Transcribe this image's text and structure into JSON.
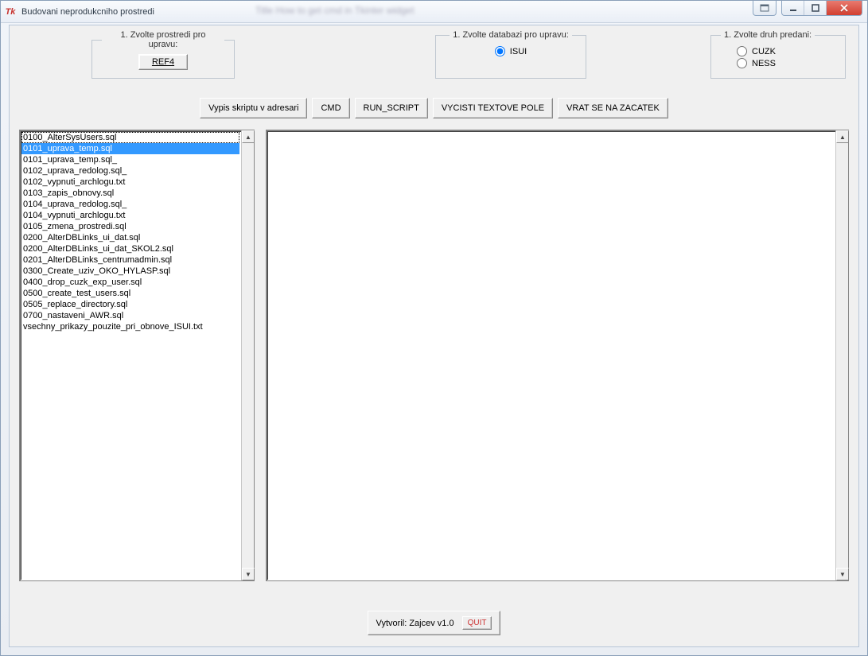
{
  "window": {
    "title": "Budovani neprodukcniho prostredi",
    "blurred_bg_text": "Title    How to get cmd in Tkinter widget"
  },
  "groups": {
    "prostredi": {
      "legend": "1. Zvolte prostredi pro upravu:",
      "button": "REF4"
    },
    "database": {
      "legend": "1. Zvolte databazi pro upravu:",
      "radio": "ISUI",
      "radio_checked": true
    },
    "predani": {
      "legend": "1. Zvolte druh predani:",
      "options": [
        "CUZK",
        "NESS"
      ],
      "selected": null
    }
  },
  "toolbar": {
    "vypis": "Vypis skriptu v adresari",
    "cmd": "CMD",
    "run": "RUN_SCRIPT",
    "vycisti": "VYCISTI TEXTOVE POLE",
    "vrat": "VRAT SE NA ZACATEK"
  },
  "file_list": {
    "selected_index": 1,
    "focused_index": 0,
    "items": [
      "0100_AlterSysUsers.sql",
      "0101_uprava_temp.sql",
      "0101_uprava_temp.sql_",
      "0102_uprava_redolog.sql_",
      "0102_vypnuti_archlogu.txt",
      "0103_zapis_obnovy.sql",
      "0104_uprava_redolog.sql_",
      "0104_vypnuti_archlogu.txt",
      "0105_zmena_prostredi.sql",
      "0200_AlterDBLinks_ui_dat.sql",
      "0200_AlterDBLinks_ui_dat_SKOL2.sql",
      "0201_AlterDBLinks_centrumadmin.sql",
      "0300_Create_uziv_OKO_HYLASP.sql",
      "0400_drop_cuzk_exp_user.sql",
      "0500_create_test_users.sql",
      "0505_replace_directory.sql",
      "0700_nastaveni_AWR.sql",
      "vsechny_prikazy_pouzite_pri_obnove_ISUI.txt"
    ]
  },
  "output_text": "",
  "footer": {
    "credit": "Vytvoril: Zajcev v1.0",
    "quit": "QUIT"
  }
}
